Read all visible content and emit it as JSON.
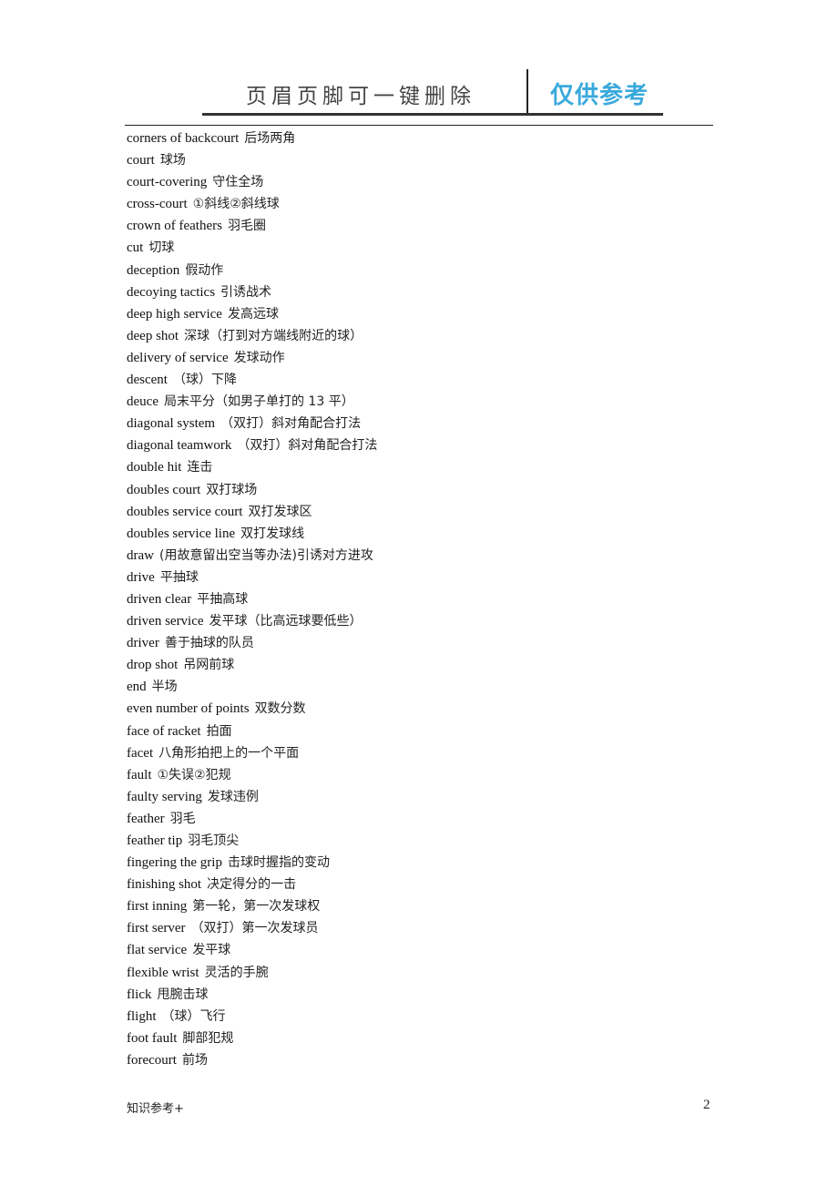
{
  "header": {
    "left_text": "页眉页脚可一键删除",
    "right_text": "仅供参考",
    "accent_color": "#3aa9dc"
  },
  "glossary": [
    {
      "term": "corners of backcourt",
      "definition": "后场两角"
    },
    {
      "term": "court",
      "definition": "球场"
    },
    {
      "term": "court-covering",
      "definition": "守住全场"
    },
    {
      "term": "cross-court",
      "definition": "①斜线②斜线球"
    },
    {
      "term": "crown of feathers",
      "definition": "羽毛圈"
    },
    {
      "term": "cut",
      "definition": "切球"
    },
    {
      "term": "deception",
      "definition": "假动作"
    },
    {
      "term": "decoying tactics",
      "definition": "引诱战术"
    },
    {
      "term": "deep high service",
      "definition": "发高远球"
    },
    {
      "term": "deep shot",
      "definition": "深球（打到对方端线附近的球）"
    },
    {
      "term": "delivery of service",
      "definition": "发球动作"
    },
    {
      "term": "descent",
      "definition": "（球）下降"
    },
    {
      "term": "deuce",
      "definition": "局末平分（如男子单打的 13 平）"
    },
    {
      "term": "diagonal system",
      "definition": "（双打）斜对角配合打法"
    },
    {
      "term": "diagonal teamwork",
      "definition": "（双打）斜对角配合打法"
    },
    {
      "term": "double hit",
      "definition": "连击"
    },
    {
      "term": "doubles court",
      "definition": "双打球场"
    },
    {
      "term": "doubles service court",
      "definition": "双打发球区"
    },
    {
      "term": "doubles service line",
      "definition": "双打发球线"
    },
    {
      "term": "draw",
      "definition": "(用故意留出空当等办法)引诱对方进攻"
    },
    {
      "term": "drive",
      "definition": "平抽球"
    },
    {
      "term": "driven clear",
      "definition": "平抽高球"
    },
    {
      "term": "driven service",
      "definition": "发平球（比高远球要低些）"
    },
    {
      "term": "driver",
      "definition": "善于抽球的队员"
    },
    {
      "term": "drop shot",
      "definition": "吊网前球"
    },
    {
      "term": "end",
      "definition": "半场"
    },
    {
      "term": "even number of points",
      "definition": "双数分数"
    },
    {
      "term": "face of racket",
      "definition": "拍面"
    },
    {
      "term": "facet",
      "definition": "八角形拍把上的一个平面"
    },
    {
      "term": "fault",
      "definition": "①失误②犯规"
    },
    {
      "term": "faulty serving",
      "definition": "发球违例"
    },
    {
      "term": "feather",
      "definition": "羽毛"
    },
    {
      "term": "feather tip",
      "definition": "羽毛顶尖"
    },
    {
      "term": "fingering the grip",
      "definition": "击球时握指的变动"
    },
    {
      "term": "finishing shot",
      "definition": "决定得分的一击"
    },
    {
      "term": "first inning",
      "definition": "第一轮，第一次发球权"
    },
    {
      "term": "first server",
      "definition": "（双打）第一次发球员"
    },
    {
      "term": "flat service",
      "definition": "发平球"
    },
    {
      "term": "flexible wrist",
      "definition": "灵活的手腕"
    },
    {
      "term": "flick",
      "definition": "甩腕击球"
    },
    {
      "term": "flight",
      "definition": "（球）飞行"
    },
    {
      "term": "foot fault",
      "definition": "脚部犯规"
    },
    {
      "term": "forecourt",
      "definition": "前场"
    }
  ],
  "footer": {
    "left_text": "知识参考+",
    "page_number": "2"
  }
}
